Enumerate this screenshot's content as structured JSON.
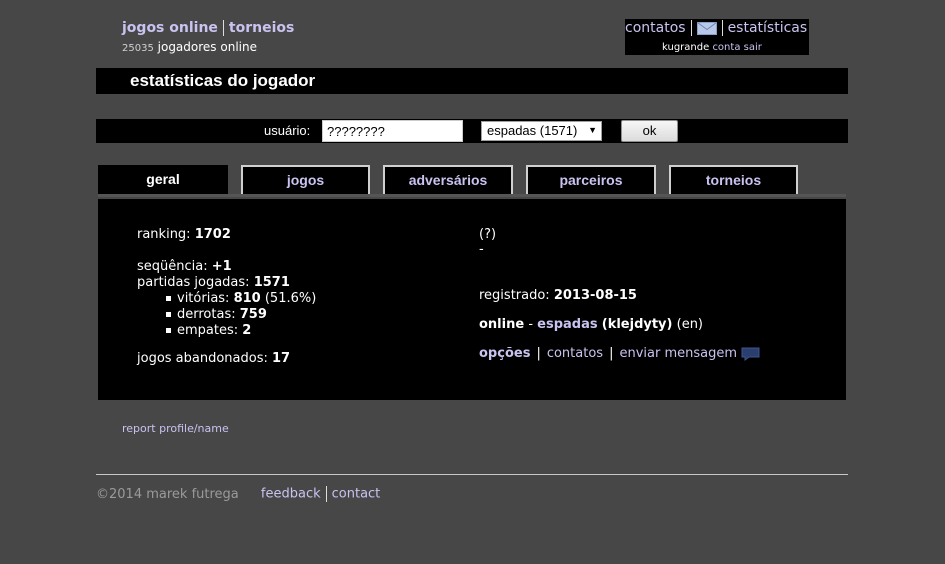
{
  "header": {
    "nav_games": "jogos online",
    "nav_tournaments": "torneios",
    "online_count": "25035",
    "online_label": "jogadores online"
  },
  "user_box": {
    "contacts": "contatos",
    "mail_icon": "envelope-icon",
    "stats": "estatísticas",
    "username": "kugrande",
    "account": "conta",
    "logout": "sair"
  },
  "page_title": "estatísticas do jogador",
  "search": {
    "label": "usuário:",
    "value": "????????",
    "game_select": "espadas (1571)",
    "ok_label": "ok"
  },
  "tabs": [
    {
      "label": "geral",
      "active": true
    },
    {
      "label": "jogos"
    },
    {
      "label": "adversários"
    },
    {
      "label": "parceiros"
    },
    {
      "label": "torneios"
    }
  ],
  "stats": {
    "ranking_label": "ranking:",
    "ranking_value": "1702",
    "streak_label": "seqüência:",
    "streak_value": "+1",
    "played_label": "partidas jogadas:",
    "played_value": "1571",
    "wins_label": "vitórias:",
    "wins_value": "810",
    "wins_pct": "(51.6%)",
    "losses_label": "derrotas:",
    "losses_value": "759",
    "draws_label": "empates:",
    "draws_value": "2",
    "abandoned_label": "jogos abandonados:",
    "abandoned_value": "17"
  },
  "profile": {
    "help": "(?)",
    "dash": "-",
    "registered_label": "registrado:",
    "registered_value": "2013-08-15",
    "status": "online",
    "status_sep": "-",
    "game": "espadas",
    "player": "(klejdyty)",
    "lang": "(en)",
    "options": "opções",
    "contacts": "contatos",
    "send_message": "enviar mensagem",
    "message_icon": "chat-bubble-icon"
  },
  "report_link": "report profile/name",
  "footer": {
    "copyright": "©2014 marek futrega",
    "feedback": "feedback",
    "contact": "contact"
  },
  "colors": {
    "background": "#474747",
    "panel": "#000000",
    "link": "#c9c3f0"
  }
}
